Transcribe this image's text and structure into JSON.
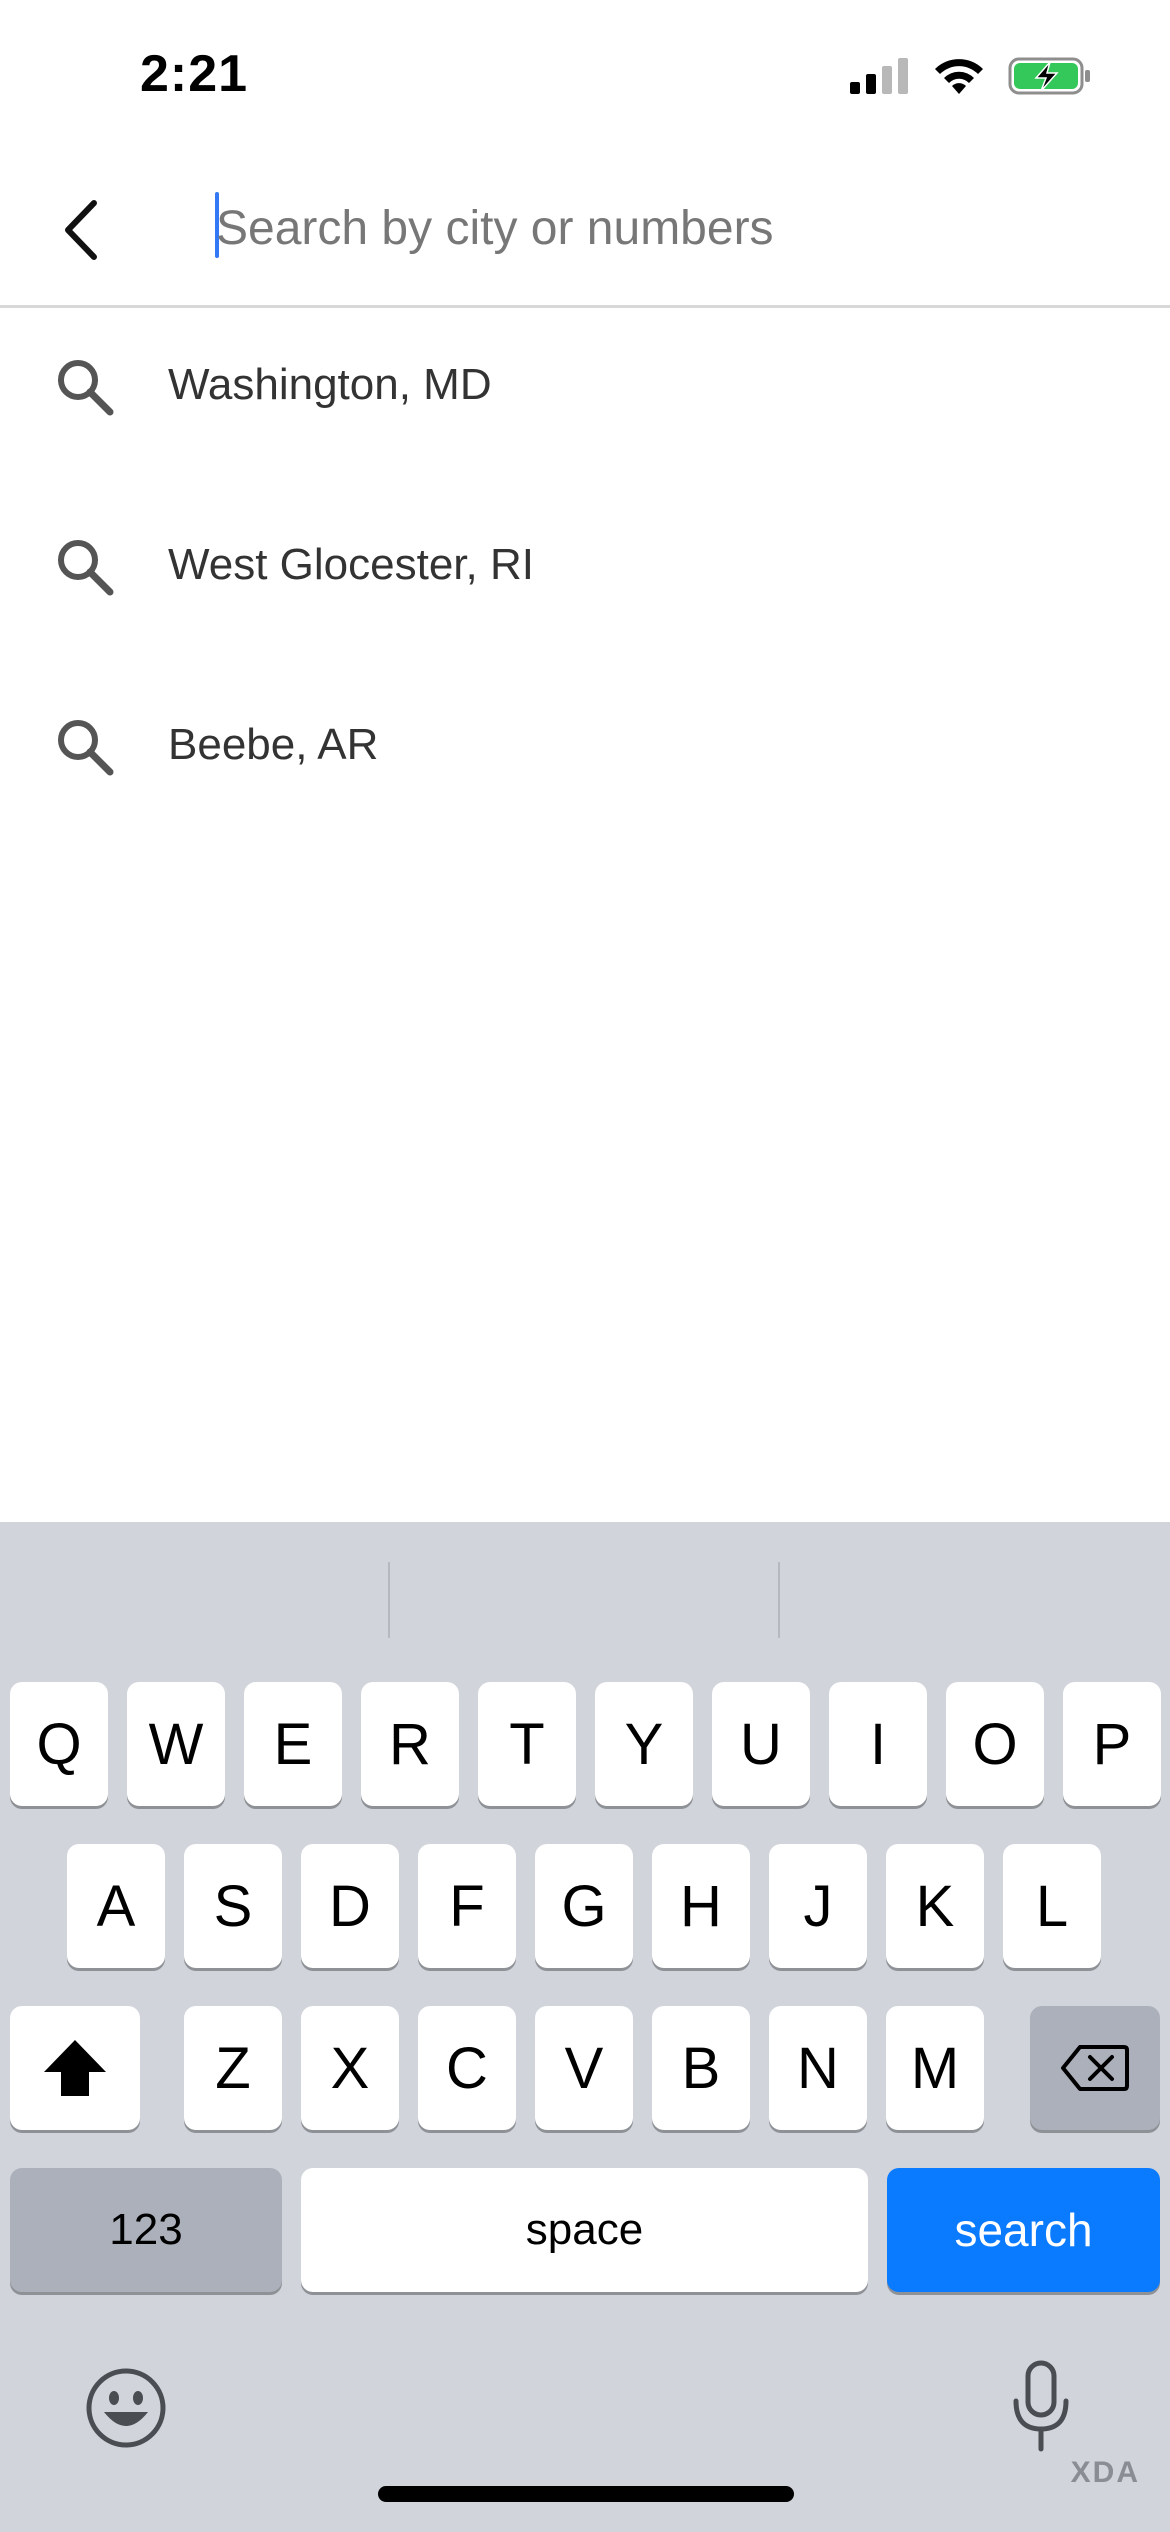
{
  "status_bar": {
    "time": "2:21"
  },
  "search": {
    "placeholder": "Search by city or numbers",
    "value": ""
  },
  "suggestions": [
    {
      "label": "Washington, MD"
    },
    {
      "label": "West Glocester, RI"
    },
    {
      "label": "Beebe, AR"
    }
  ],
  "keyboard": {
    "row1": [
      "Q",
      "W",
      "E",
      "R",
      "T",
      "Y",
      "U",
      "I",
      "O",
      "P"
    ],
    "row2": [
      "A",
      "S",
      "D",
      "F",
      "G",
      "H",
      "J",
      "K",
      "L"
    ],
    "row3": [
      "Z",
      "X",
      "C",
      "V",
      "B",
      "N",
      "M"
    ],
    "numbers_label": "123",
    "space_label": "space",
    "search_label": "search"
  },
  "watermark": "XDA",
  "colors": {
    "accent": "#0a7aff",
    "keyboard_bg": "#d1d4db",
    "battery": "#34c759"
  }
}
